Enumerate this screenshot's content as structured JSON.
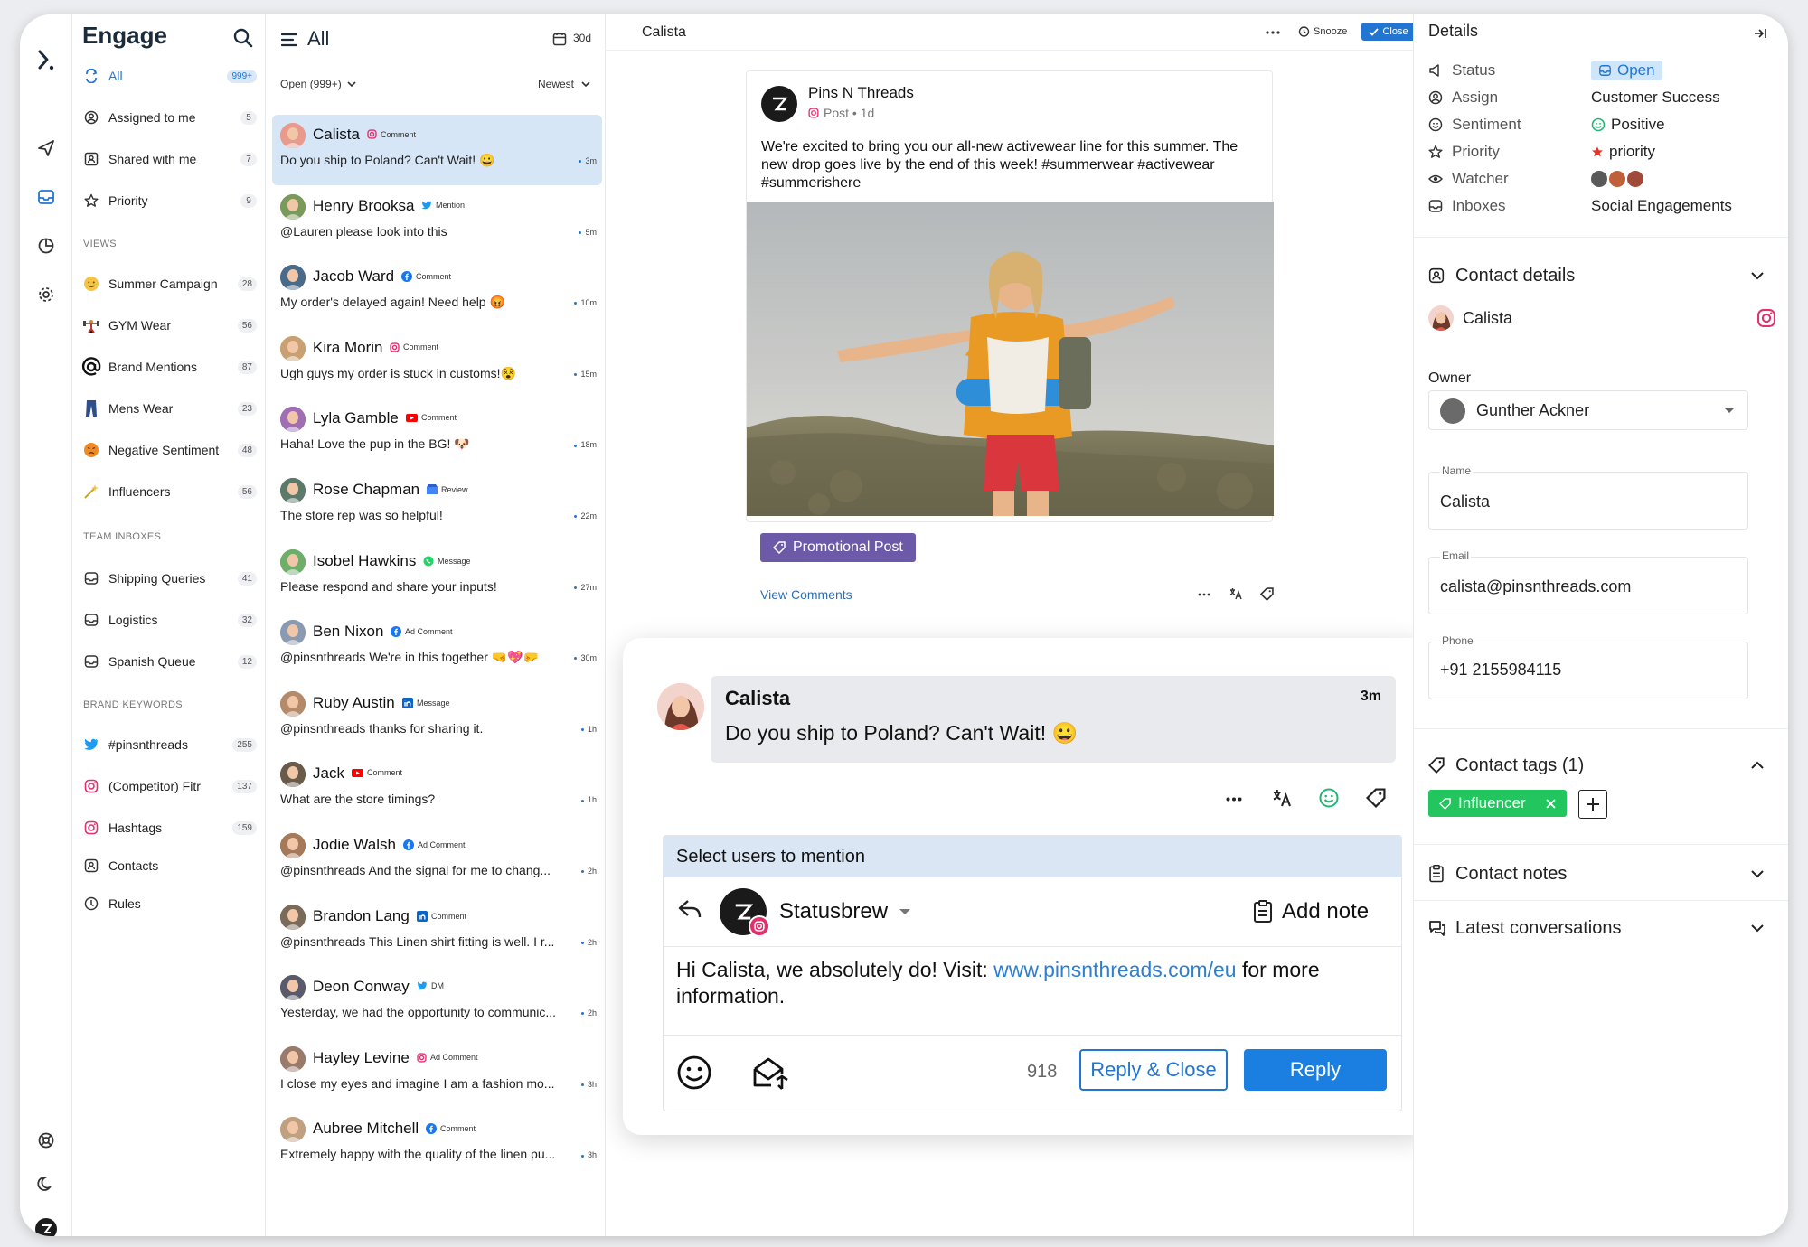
{
  "nav": {
    "brand": "Engage",
    "items": [
      {
        "label": "All",
        "count": "999+"
      },
      {
        "label": "Assigned to me",
        "count": "5"
      },
      {
        "label": "Shared with me",
        "count": "7"
      },
      {
        "label": "Priority",
        "count": "9"
      }
    ],
    "views_title": "VIEWS",
    "views": [
      {
        "label": "Summer Campaign",
        "count": "28",
        "icon": "smiley-icon"
      },
      {
        "label": "GYM Wear",
        "count": "56",
        "icon": "weightlifter-icon"
      },
      {
        "label": "Brand Mentions",
        "count": "87",
        "icon": "at-icon"
      },
      {
        "label": "Mens Wear",
        "count": "23",
        "icon": "trousers-icon"
      },
      {
        "label": "Negative Sentiment",
        "count": "48",
        "icon": "angry-face-icon"
      },
      {
        "label": "Influencers",
        "count": "56",
        "icon": "sparkle-icon"
      }
    ],
    "team_title": "TEAM INBOXES",
    "team": [
      {
        "label": "Shipping Queries",
        "count": "41"
      },
      {
        "label": "Logistics",
        "count": "32"
      },
      {
        "label": "Spanish Queue",
        "count": "12"
      }
    ],
    "keywords_title": "BRAND KEYWORDS",
    "keywords": [
      {
        "label": "#pinsnthreads",
        "count": "255",
        "icon": "twitter-icon"
      },
      {
        "label": "(Competitor) Fitr",
        "count": "137",
        "icon": "instagram-icon"
      },
      {
        "label": "Hashtags",
        "count": "159",
        "icon": "instagram-icon"
      }
    ],
    "extra": [
      {
        "label": "Contacts"
      },
      {
        "label": "Rules"
      }
    ]
  },
  "list": {
    "title": "All",
    "range": "30d",
    "filter": "Open (999+)",
    "sort": "Newest",
    "conversations": [
      {
        "name": "Calista",
        "type": "Comment",
        "network": "instagram",
        "preview": "Do you ship to Poland? Can't Wait! 😀",
        "time": "3m",
        "color": "#e89a8c"
      },
      {
        "name": "Henry Brooksa",
        "type": "Mention",
        "network": "twitter",
        "preview": "@Lauren please look into this",
        "time": "5m",
        "color": "#7a9a5b"
      },
      {
        "name": "Jacob Ward",
        "type": "Comment",
        "network": "facebook",
        "preview": "My order's delayed again! Need help 😡",
        "time": "10m",
        "color": "#4a6a8a"
      },
      {
        "name": "Kira Morin",
        "type": "Comment",
        "network": "instagram",
        "preview": "Ugh guys my order is stuck in customs!😵",
        "time": "15m",
        "color": "#c9a071"
      },
      {
        "name": "Lyla Gamble",
        "type": "Comment",
        "network": "youtube",
        "preview": "Haha! Love the pup in the BG! 🐶",
        "time": "18m",
        "color": "#a06fb3"
      },
      {
        "name": "Rose Chapman",
        "type": "Review",
        "network": "gmb",
        "preview": "The store rep was so helpful!",
        "time": "22m",
        "color": "#5c7a6a"
      },
      {
        "name": "Isobel Hawkins",
        "type": "Message",
        "network": "whatsapp",
        "preview": "Please respond and share your inputs!",
        "time": "27m",
        "color": "#6fae6a"
      },
      {
        "name": "Ben Nixon",
        "type": "Ad Comment",
        "network": "facebook",
        "preview": "@pinsnthreads We're in this together 🤜💖🤛",
        "time": "30m",
        "color": "#8a9ab0"
      },
      {
        "name": "Ruby Austin",
        "type": "Message",
        "network": "linkedin",
        "preview": "@pinsnthreads thanks for sharing it.",
        "time": "1h",
        "color": "#b58a6a"
      },
      {
        "name": "Jack",
        "type": "Comment",
        "network": "youtube",
        "preview": "What are the store timings?",
        "time": "1h",
        "color": "#6a5a4a"
      },
      {
        "name": "Jodie Walsh",
        "type": "Ad Comment",
        "network": "facebook",
        "preview": "@pinsnthreads And the signal for me to chang...",
        "time": "2h",
        "color": "#a57a5a"
      },
      {
        "name": "Brandon Lang",
        "type": "Comment",
        "network": "linkedin",
        "preview": "@pinsnthreads This Linen shirt fitting is well. I r...",
        "time": "2h",
        "color": "#7a6a5a"
      },
      {
        "name": "Deon Conway",
        "type": "DM",
        "network": "twitter",
        "preview": "Yesterday, we had the opportunity to communic...",
        "time": "2h",
        "color": "#5a5a6a"
      },
      {
        "name": "Hayley Levine",
        "type": "Ad Comment",
        "network": "instagram",
        "preview": "I close my eyes and imagine I am a fashion mo...",
        "time": "3h",
        "color": "#9a7a6a"
      },
      {
        "name": "Aubree Mitchell",
        "type": "Comment",
        "network": "facebook",
        "preview": "Extremely happy with the quality of the linen pu...",
        "time": "3h",
        "color": "#c0a080"
      }
    ]
  },
  "conv": {
    "title": "Calista",
    "snooze": "Snooze",
    "close": "Close",
    "post": {
      "author": "Pins N Threads",
      "meta": "Post • 1d",
      "text": "We're excited to bring you our all-new activewear line for this summer. The new drop goes live by the end of this week! #summerwear #activewear #summerishere",
      "tag": "Promotional Post",
      "view_comments": "View Comments"
    },
    "comment": {
      "name": "Calista",
      "time": "3m",
      "text": "Do you ship to Poland? Can't Wait! 😀"
    },
    "reply": {
      "mention_bar": "Select users to mention",
      "account": "Statusbrew",
      "add_note": "Add note",
      "text_before": "Hi Calista, we absolutely do! Visit: ",
      "link": "www.pinsnthreads.com/eu",
      "text_after": " for more information.",
      "char_count": "918",
      "reply_close": "Reply & Close",
      "reply": "Reply"
    }
  },
  "details": {
    "title": "Details",
    "rows": [
      {
        "label": "Status",
        "value": "Open"
      },
      {
        "label": "Assign",
        "value": "Customer Success"
      },
      {
        "label": "Sentiment",
        "value": "Positive"
      },
      {
        "label": "Priority",
        "value": "priority"
      },
      {
        "label": "Watcher",
        "value": ""
      },
      {
        "label": "Inboxes",
        "value": "Social Engagements"
      }
    ],
    "contact_title": "Contact details",
    "contact_name": "Calista",
    "owner_label": "Owner",
    "owner": "Gunther Ackner",
    "name_label": "Name",
    "name": "Calista",
    "email_label": "Email",
    "email": "calista@pinsnthreads.com",
    "phone_label": "Phone",
    "phone": "+91 2155984115",
    "tags_title": "Contact tags (1)",
    "tag": "Influencer",
    "notes_title": "Contact notes",
    "latest_title": "Latest conversations"
  },
  "colors": {
    "accent": "#2276d2",
    "selected_row": "#d6e6f7",
    "tag_purple": "#6c5aa8",
    "tag_green": "#22c55e",
    "link": "#2d7fd3"
  }
}
